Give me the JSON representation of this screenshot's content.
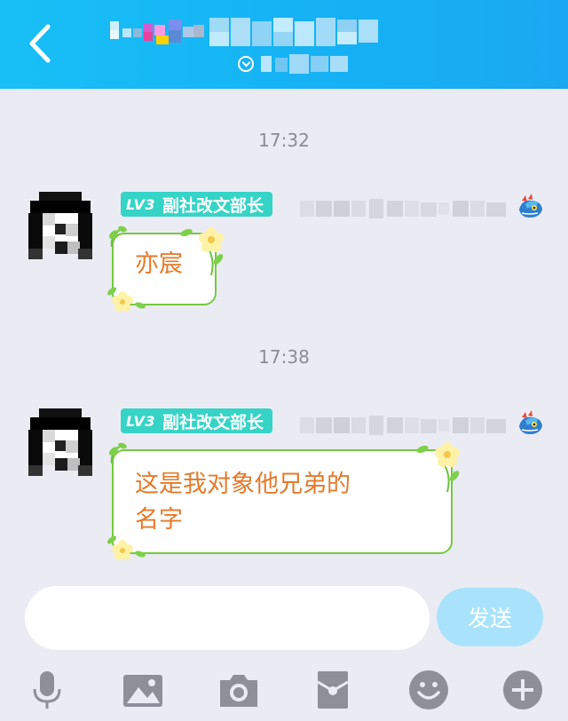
{
  "header": {
    "back_icon": "chevron-left-icon",
    "subtitle_icon": "chevron-down-circle-icon"
  },
  "messages": [
    {
      "time": "17:32",
      "level": "LV3",
      "role": "副社改文部长",
      "text": "亦宸"
    },
    {
      "time": "17:38",
      "level": "LV3",
      "role": "副社改文部长",
      "text_line1": "这是我对象他兄弟的",
      "text_line2": "名字"
    }
  ],
  "input": {
    "placeholder": "",
    "send_label": "发送"
  },
  "toolbar": {
    "icons": [
      "microphone-icon",
      "image-icon",
      "camera-icon",
      "red-packet-icon",
      "emoji-icon",
      "plus-icon"
    ]
  },
  "colors": {
    "header": "#18bff6",
    "badge": "#35d4c6",
    "bubble_border": "#75c93f",
    "bubble_text": "#e47a2b",
    "send_button": "#a9e3fb",
    "icon_gray": "#8f8f9a"
  }
}
